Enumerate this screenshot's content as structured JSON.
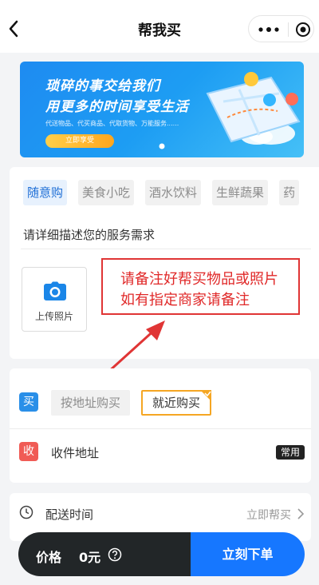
{
  "header": {
    "title": "帮我买"
  },
  "banner": {
    "line1": "琐碎的事交给我们",
    "line2": "用更多的时间享受生活",
    "subtitle": "代送物品、代买商品、代取货物、万能服务......",
    "cta": "立即享受",
    "colors": {
      "start": "#1e8bf1",
      "end": "#45c0f7"
    }
  },
  "categories": {
    "tabs": [
      {
        "label": "随意购",
        "active": true
      },
      {
        "label": "美食小吃",
        "active": false
      },
      {
        "label": "酒水饮料",
        "active": false
      },
      {
        "label": "生鲜蔬果",
        "active": false
      },
      {
        "label": "药",
        "active": false
      }
    ]
  },
  "request": {
    "placeholder": "请详细描述您的服务需求",
    "upload_label": "上传照片"
  },
  "annotation": {
    "line1": "请备注好帮买物品或照片",
    "line2": "如有指定商家请备注",
    "color": "#e03535"
  },
  "purchase": {
    "badge": "买",
    "options": [
      {
        "label": "按地址购买",
        "selected": false
      },
      {
        "label": "就近购买",
        "selected": true
      }
    ]
  },
  "receiver": {
    "badge": "收",
    "label": "收件地址",
    "tag": "常用"
  },
  "delivery": {
    "label": "配送时间",
    "value": "立即帮买"
  },
  "footer": {
    "price_label": "价格",
    "price_value": "0元",
    "submit": "立刻下单",
    "accent": "#1677ff"
  }
}
